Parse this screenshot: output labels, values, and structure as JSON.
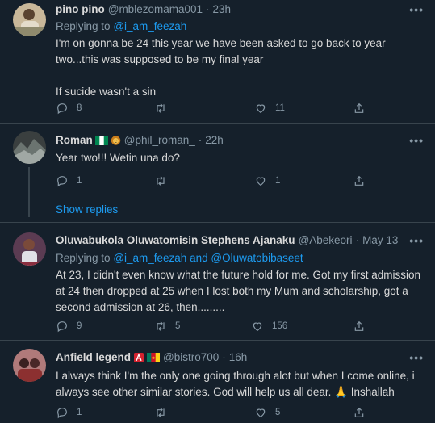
{
  "tweets": [
    {
      "name": "pino pino",
      "handle": "@mblezomama001",
      "time": "23h",
      "replying_to_label": "Replying to",
      "replying_to": "@i_am_feezah",
      "text_1": "I'm on gonna be 24 this year we have been asked to go back to year two...this was supposed to be my final year",
      "text_2": "If sucide wasn't a sin",
      "replies": "8",
      "retweets": "",
      "likes": "11"
    },
    {
      "name": "Roman",
      "handle": "@phil_roman_",
      "time": "22h",
      "text_1": "Year two!!! Wetin una do?",
      "replies": "1",
      "retweets": "",
      "likes": "1",
      "show_replies": "Show replies"
    },
    {
      "name": "Oluwabukola Oluwatomisin Stephens Ajanaku",
      "handle": "@Abekeori",
      "time": "May 13",
      "replying_to_label": "Replying to",
      "replying_to": "@i_am_feezah",
      "replying_and": "and",
      "replying_to_2": "@Oluwatobibaseet",
      "text_1": "At 23, I didn't even know what the future hold for me. Got my first admission at 24 then dropped at 25 when I lost both my Mum and scholarship, got a second admission at 26, then.........",
      "replies": "9",
      "retweets": "5",
      "likes": "156"
    },
    {
      "name": "Anfield legend",
      "handle": "@bistro700",
      "time": "16h",
      "text_1": "I always think I'm the only one going through alot but when I come online, i always see other similar stories. God will help us all dear. 🙏 Inshallah",
      "replies": "1",
      "retweets": "",
      "likes": "5"
    }
  ],
  "separator": "·",
  "more_label": "•••",
  "colors": {
    "background": "#15202b",
    "link": "#1d9bf0",
    "muted": "#8899a6",
    "text": "#d9d9d9",
    "border": "#38444d"
  }
}
